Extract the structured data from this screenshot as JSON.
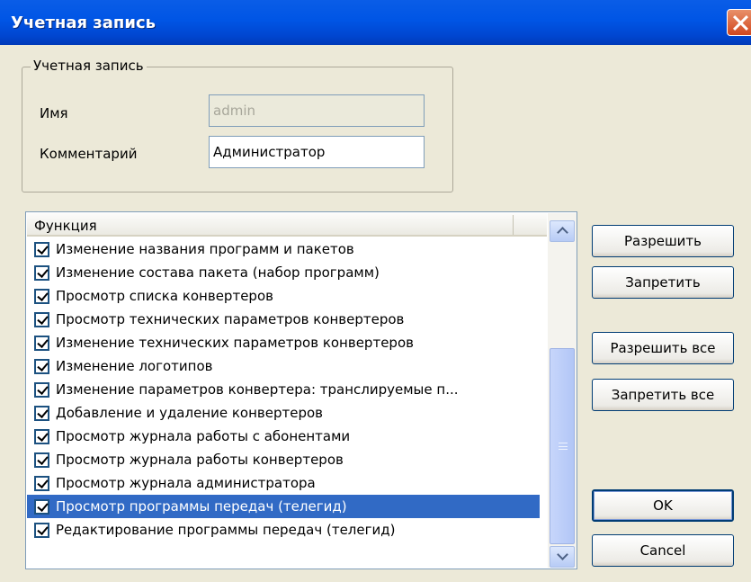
{
  "window": {
    "title": "Учетная запись"
  },
  "account_group": {
    "legend": "Учетная запись",
    "name_label": "Имя",
    "name_value": "admin",
    "comment_label": "Комментарий",
    "comment_value": "Администратор"
  },
  "functions_list": {
    "column_header": "Функция",
    "items": [
      {
        "label": "Изменение названия программ и пакетов",
        "checked": true,
        "selected": false
      },
      {
        "label": "Изменение состава пакета (набор программ)",
        "checked": true,
        "selected": false
      },
      {
        "label": "Просмотр списка конвертеров",
        "checked": true,
        "selected": false
      },
      {
        "label": "Просмотр технических параметров конвертеров",
        "checked": true,
        "selected": false
      },
      {
        "label": "Изменение технических параметров конвертеров",
        "checked": true,
        "selected": false
      },
      {
        "label": "Изменение логотипов",
        "checked": true,
        "selected": false
      },
      {
        "label": "Изменение параметров конвертера: транслируемые п...",
        "checked": true,
        "selected": false
      },
      {
        "label": "Добавление и удаление конвертеров",
        "checked": true,
        "selected": false
      },
      {
        "label": "Просмотр журнала работы с абонентами",
        "checked": true,
        "selected": false
      },
      {
        "label": "Просмотр журнала работы конвертеров",
        "checked": true,
        "selected": false
      },
      {
        "label": "Просмотр журнала администратора",
        "checked": true,
        "selected": false
      },
      {
        "label": "Просмотр программы передач (телегид)",
        "checked": true,
        "selected": true
      },
      {
        "label": "Редактирование программы передач (телегид)",
        "checked": true,
        "selected": false
      }
    ]
  },
  "buttons": {
    "allow": "Разрешить",
    "deny": "Запретить",
    "allow_all": "Разрешить все",
    "deny_all": "Запретить все",
    "ok": "OK",
    "cancel": "Cancel"
  },
  "colors": {
    "titlebar": "#0055e5",
    "selection": "#316ac5",
    "window_bg": "#ece9d8"
  }
}
